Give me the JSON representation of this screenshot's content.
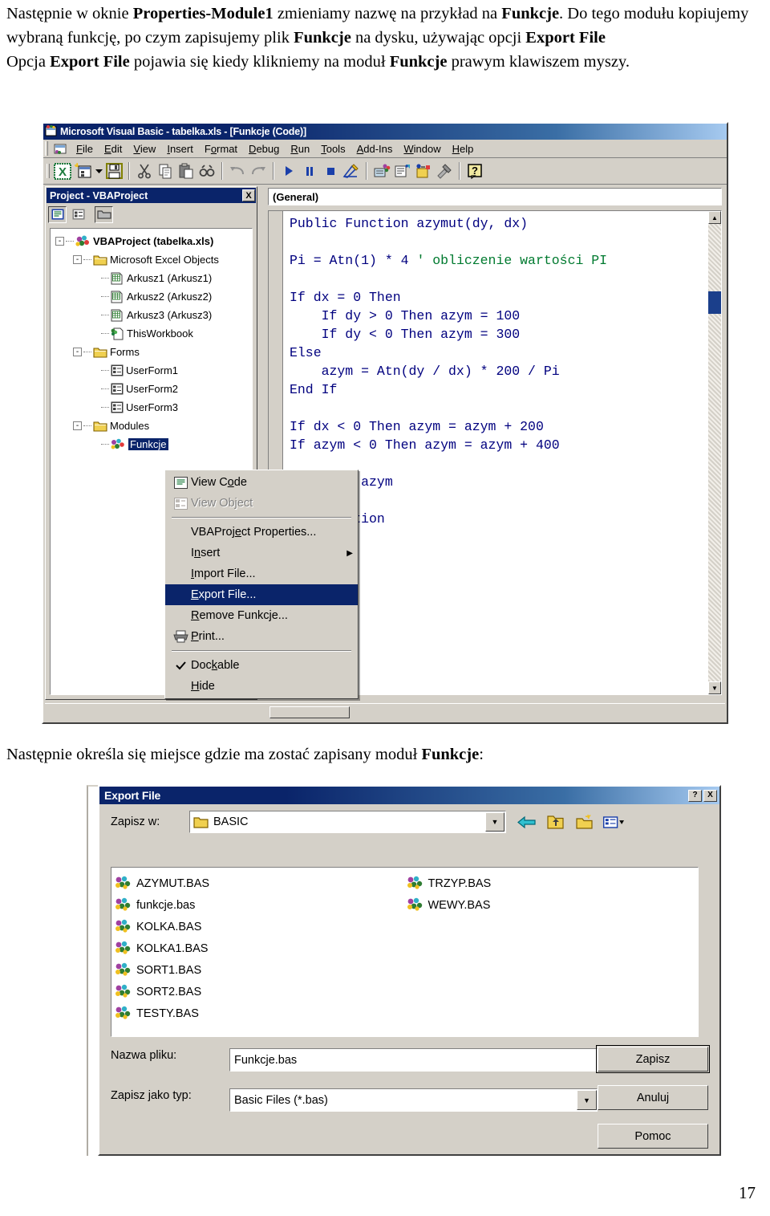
{
  "document": {
    "paragraph1_html": "Następnie w oknie <b>Properties-Module1</b> zmieniamy nazwę na przykład na <b>Funkcje</b>. Do tego modułu kopiujemy wybraną funkcję, po czym zapisujemy plik <b>Funkcje</b> na dysku, używając opcji <b>Export File</b><br>Opcja <b>Export File</b> pojawia się kiedy klikniemy na moduł <b>Funkcje</b> prawym klawiszem myszy.",
    "paragraph2_html": "Następnie określa się miejsce gdzie ma zostać zapisany moduł <b>Funkcje</b>:",
    "page_number": "17"
  },
  "vbe": {
    "title": "Microsoft Visual Basic - tabelka.xls - [Funkcje (Code)]",
    "menu": [
      {
        "label": "File",
        "accel": "F"
      },
      {
        "label": "Edit",
        "accel": "E"
      },
      {
        "label": "View",
        "accel": "V"
      },
      {
        "label": "Insert",
        "accel": "I"
      },
      {
        "label": "Format",
        "accel": "o"
      },
      {
        "label": "Debug",
        "accel": "D"
      },
      {
        "label": "Run",
        "accel": "R"
      },
      {
        "label": "Tools",
        "accel": "T"
      },
      {
        "label": "Add-Ins",
        "accel": "A"
      },
      {
        "label": "Window",
        "accel": "W"
      },
      {
        "label": "Help",
        "accel": "H"
      }
    ],
    "toolbar": [
      {
        "name": "view-excel-icon"
      },
      {
        "name": "insert-userform-icon"
      },
      {
        "name": "insert-dropdown-icon"
      },
      {
        "name": "save-icon"
      },
      {
        "name": "cut-icon"
      },
      {
        "name": "copy-icon"
      },
      {
        "name": "paste-icon"
      },
      {
        "name": "find-icon"
      },
      {
        "name": "undo-icon"
      },
      {
        "name": "redo-icon"
      },
      {
        "name": "run-icon"
      },
      {
        "name": "break-icon"
      },
      {
        "name": "reset-icon"
      },
      {
        "name": "design-mode-icon"
      },
      {
        "name": "project-explorer-icon"
      },
      {
        "name": "properties-window-icon"
      },
      {
        "name": "object-browser-icon"
      },
      {
        "name": "toolbox-icon"
      },
      {
        "name": "help-icon"
      }
    ],
    "project_explorer": {
      "title": "Project - VBAProject",
      "close_label": "X",
      "toolbar": [
        {
          "name": "view-code-icon"
        },
        {
          "name": "view-object-icon"
        },
        {
          "name": "toggle-folders-icon"
        }
      ],
      "tree": [
        {
          "label": "VBAProject (tabelka.xls)",
          "depth": 0,
          "expander": "-",
          "icon": "vbaproject-icon",
          "bold": true,
          "selected": false
        },
        {
          "label": "Microsoft Excel Objects",
          "depth": 1,
          "expander": "-",
          "icon": "folder-icon",
          "bold": false,
          "selected": false
        },
        {
          "label": "Arkusz1 (Arkusz1)",
          "depth": 2,
          "expander": "",
          "icon": "sheet-icon",
          "bold": false,
          "selected": false
        },
        {
          "label": "Arkusz2 (Arkusz2)",
          "depth": 2,
          "expander": "",
          "icon": "sheet-icon",
          "bold": false,
          "selected": false
        },
        {
          "label": "Arkusz3 (Arkusz3)",
          "depth": 2,
          "expander": "",
          "icon": "sheet-icon",
          "bold": false,
          "selected": false
        },
        {
          "label": "ThisWorkbook",
          "depth": 2,
          "expander": "",
          "icon": "workbook-icon",
          "bold": false,
          "selected": false
        },
        {
          "label": "Forms",
          "depth": 1,
          "expander": "-",
          "icon": "folder-icon",
          "bold": false,
          "selected": false
        },
        {
          "label": "UserForm1",
          "depth": 2,
          "expander": "",
          "icon": "userform-icon",
          "bold": false,
          "selected": false
        },
        {
          "label": "UserForm2",
          "depth": 2,
          "expander": "",
          "icon": "userform-icon",
          "bold": false,
          "selected": false
        },
        {
          "label": "UserForm3",
          "depth": 2,
          "expander": "",
          "icon": "userform-icon",
          "bold": false,
          "selected": false
        },
        {
          "label": "Modules",
          "depth": 1,
          "expander": "-",
          "icon": "folder-icon",
          "bold": false,
          "selected": false
        },
        {
          "label": "Funkcje",
          "depth": 2,
          "expander": "",
          "icon": "module-icon",
          "bold": false,
          "selected": true
        }
      ]
    },
    "code_pane": {
      "object_combo": "(General)",
      "proc_combo": "",
      "code_lines": [
        {
          "text": "Public Function azymut(dy, dx)",
          "comment": ""
        },
        {
          "text": "",
          "comment": ""
        },
        {
          "text": "Pi = Atn(1) * 4 ",
          "comment": "' obliczenie wartości PI"
        },
        {
          "text": "",
          "comment": ""
        },
        {
          "text": "If dx = 0 Then",
          "comment": ""
        },
        {
          "text": "    If dy > 0 Then azym = 100",
          "comment": ""
        },
        {
          "text": "    If dy < 0 Then azym = 300",
          "comment": ""
        },
        {
          "text": "Else",
          "comment": ""
        },
        {
          "text": "    azym = Atn(dy / dx) * 200 / Pi",
          "comment": ""
        },
        {
          "text": "End If",
          "comment": ""
        },
        {
          "text": "",
          "comment": ""
        },
        {
          "text": "If dx < 0 Then azym = azym + 200",
          "comment": ""
        },
        {
          "text": "If azym < 0 Then azym = azym + 400",
          "comment": ""
        },
        {
          "text": "",
          "comment": ""
        },
        {
          "text": "azymut = azym",
          "comment": ""
        },
        {
          "text": "",
          "comment": ""
        },
        {
          "text": "End Function",
          "comment": ""
        }
      ]
    }
  },
  "context_menu": {
    "items": [
      {
        "label": "View Code",
        "accel": "o",
        "icon": "view-code-icon",
        "state": "normal"
      },
      {
        "label": "View Object",
        "accel": "j",
        "icon": "view-object-icon",
        "state": "disabled"
      },
      {
        "separator": true
      },
      {
        "label": "VBAProject Properties...",
        "accel": "e",
        "icon": "",
        "state": "normal"
      },
      {
        "label": "Insert",
        "accel": "n",
        "icon": "",
        "state": "normal",
        "submenu": true
      },
      {
        "label": "Import File...",
        "accel": "I",
        "icon": "",
        "state": "normal"
      },
      {
        "label": "Export File...",
        "accel": "E",
        "icon": "",
        "state": "selected"
      },
      {
        "label": "Remove Funkcje...",
        "accel": "R",
        "icon": "",
        "state": "normal"
      },
      {
        "label": "Print...",
        "accel": "P",
        "icon": "print-icon",
        "state": "normal"
      },
      {
        "separator": true
      },
      {
        "label": "Dockable",
        "accel": "k",
        "icon": "check-icon",
        "state": "checked"
      },
      {
        "label": "Hide",
        "accel": "H",
        "icon": "",
        "state": "normal"
      }
    ]
  },
  "export_dialog": {
    "title": "Export File",
    "help_button": "?",
    "close_button": "X",
    "look_in_label": "Zapisz w:",
    "look_in_value": "BASIC",
    "nav_icons": [
      {
        "name": "back-icon"
      },
      {
        "name": "up-one-level-icon"
      },
      {
        "name": "new-folder-icon"
      },
      {
        "name": "views-icon"
      }
    ],
    "files": [
      {
        "name": "AZYMUT.BAS",
        "icon": "basic-module-icon"
      },
      {
        "name": "funkcje.bas",
        "icon": "basic-module-icon"
      },
      {
        "name": "KOLKA.BAS",
        "icon": "basic-module-icon"
      },
      {
        "name": "KOLKA1.BAS",
        "icon": "basic-module-icon"
      },
      {
        "name": "SORT1.BAS",
        "icon": "basic-module-icon"
      },
      {
        "name": "SORT2.BAS",
        "icon": "basic-module-icon"
      },
      {
        "name": "TESTY.BAS",
        "icon": "basic-module-icon"
      },
      {
        "name": "TRZYP.BAS",
        "icon": "basic-module-icon"
      },
      {
        "name": "WEWY.BAS",
        "icon": "basic-module-icon"
      }
    ],
    "file_name_label": "Nazwa pliku:",
    "file_name_value": "Funkcje.bas",
    "save_as_type_label": "Zapisz jako typ:",
    "save_as_type_value": "Basic Files (*.bas)",
    "buttons": {
      "save": "Zapisz",
      "cancel": "Anuluj",
      "help": "Pomoc"
    }
  },
  "colors": {
    "titlebar_start": "#0a246a",
    "titlebar_end": "#a6caf0",
    "face": "#d4d0c8",
    "selection": "#0a246a",
    "code_text": "#00007f",
    "code_comment": "#007a2f"
  }
}
